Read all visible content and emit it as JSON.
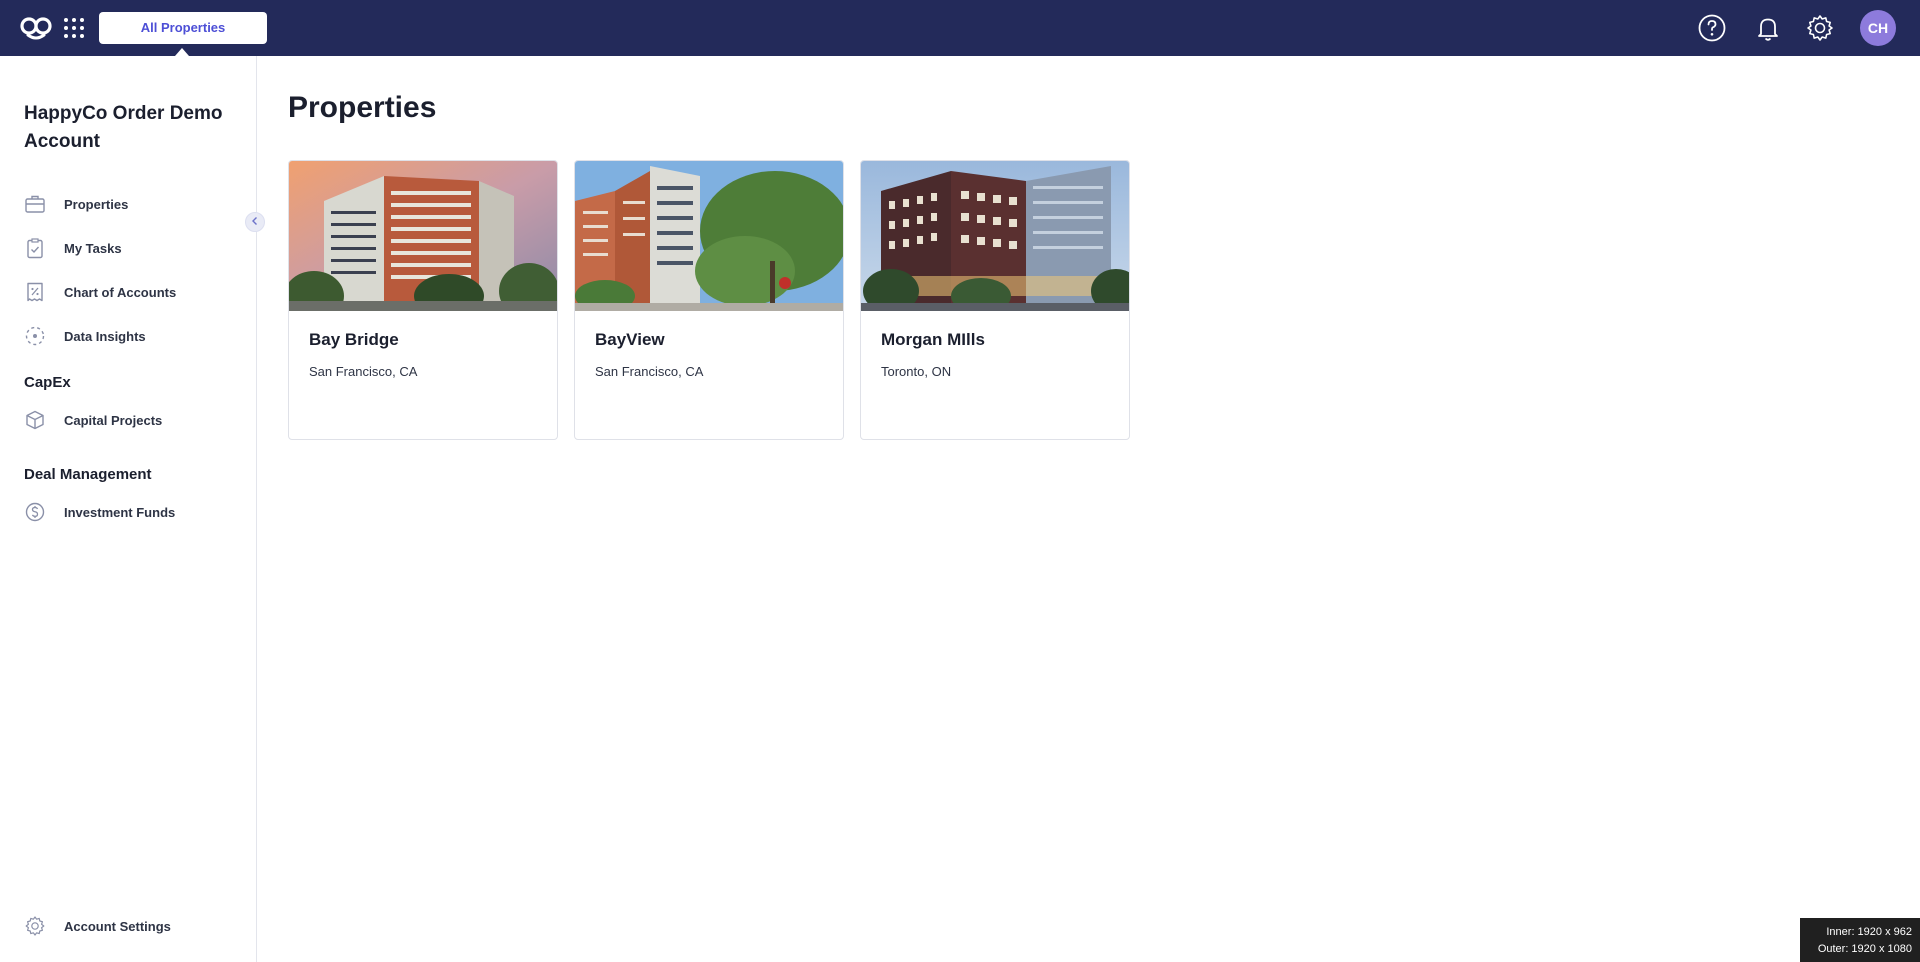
{
  "topbar": {
    "property_switcher_label": "All Properties",
    "avatar_initials": "CH",
    "brand_color": "#232a5a",
    "accent_color": "#4d4fd6",
    "icons": [
      "logo-icon",
      "apps-grid-icon",
      "help-icon",
      "bell-icon",
      "gear-icon"
    ]
  },
  "sidebar": {
    "account_name": "HappyCo Order Demo Account",
    "items": [
      {
        "label": "Properties",
        "icon": "briefcase-icon"
      },
      {
        "label": "My Tasks",
        "icon": "clipboard-check-icon"
      },
      {
        "label": "Chart of Accounts",
        "icon": "ledger-percent-icon"
      },
      {
        "label": "Data Insights",
        "icon": "dashed-circle-icon"
      }
    ],
    "sections": [
      {
        "heading": "CapEx",
        "items": [
          {
            "label": "Capital Projects",
            "icon": "box-icon"
          }
        ]
      },
      {
        "heading": "Deal Management",
        "items": [
          {
            "label": "Investment Funds",
            "icon": "dollar-circle-icon"
          }
        ]
      }
    ],
    "footer": {
      "label": "Account Settings",
      "icon": "gear-icon"
    }
  },
  "main": {
    "title": "Properties",
    "properties": [
      {
        "name": "Bay Bridge",
        "location": "San Francisco, CA"
      },
      {
        "name": "BayView",
        "location": "San Francisco, CA"
      },
      {
        "name": "Morgan MIlls",
        "location": "Toronto, ON"
      }
    ]
  },
  "window_badge": {
    "inner": "Inner: 1920 x 962",
    "outer": "Outer: 1920 x 1080"
  }
}
